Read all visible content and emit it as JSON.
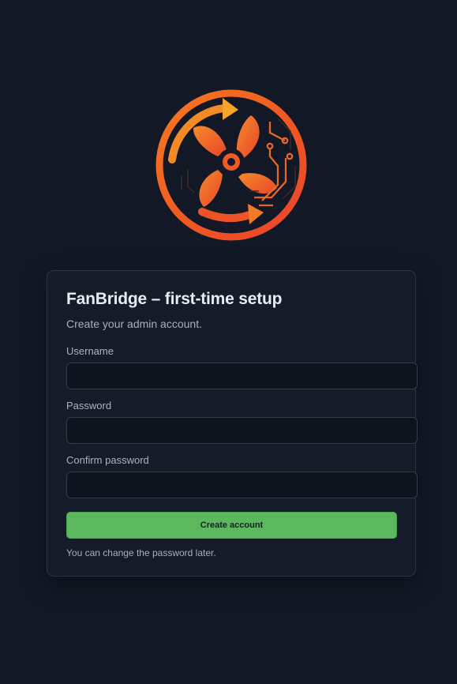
{
  "app": {
    "logo_icon": "fan-logo-icon",
    "accent_color": "#f0512a",
    "button_color": "#5cb85c"
  },
  "setup": {
    "title": "FanBridge – first-time setup",
    "subtitle": "Create your admin account.",
    "username": {
      "label": "Username",
      "value": "",
      "placeholder": ""
    },
    "password": {
      "label": "Password",
      "value": "",
      "placeholder": ""
    },
    "confirm": {
      "label": "Confirm password",
      "value": "",
      "placeholder": ""
    },
    "submit_label": "Create account",
    "hint": "You can change the password later."
  }
}
